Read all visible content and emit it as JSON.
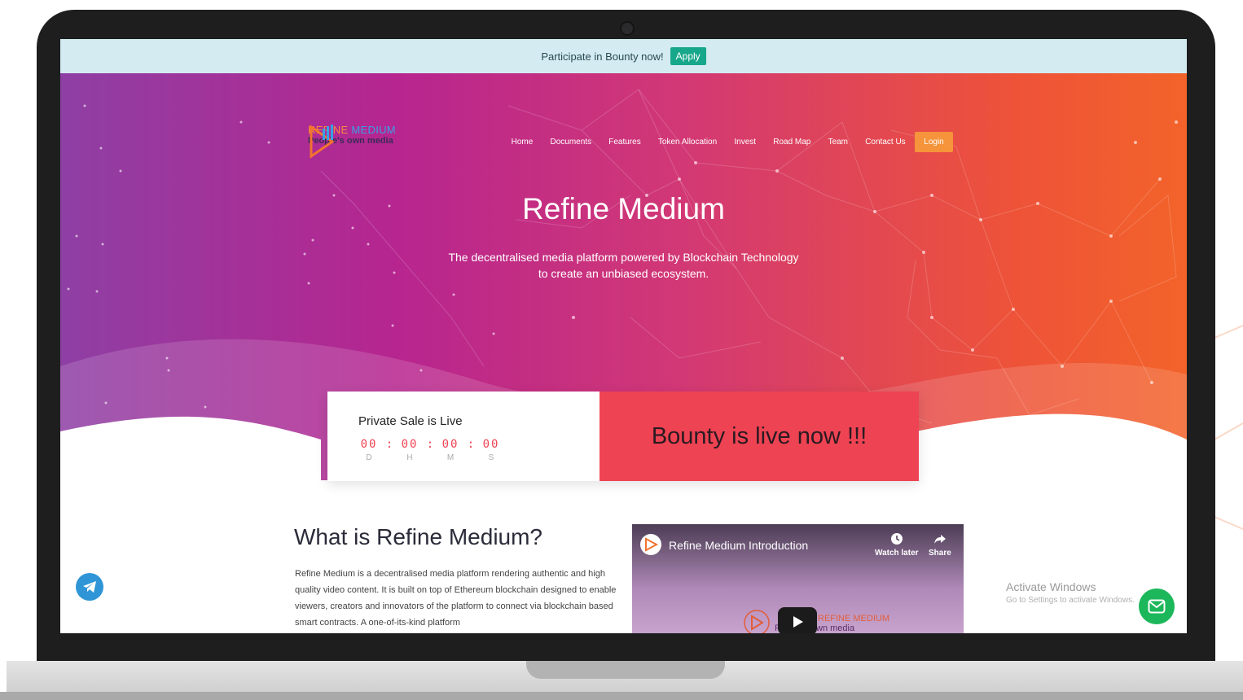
{
  "topbar": {
    "text": "Participate in Bounty now!",
    "apply_label": "Apply"
  },
  "logo": {
    "title_part1": "REFINE",
    "title_part2": "MEDIUM",
    "subtitle": "People's own media"
  },
  "nav": {
    "items": [
      "Home",
      "Documents",
      "Features",
      "Token Allocation",
      "Invest",
      "Road Map",
      "Team",
      "Contact Us"
    ],
    "login_label": "Login"
  },
  "hero": {
    "title": "Refine Medium",
    "subtitle_line1": "The decentralised media platform powered by Blockchain Technology",
    "subtitle_line2": "to create an unbiased ecosystem."
  },
  "sale": {
    "title": "Private Sale is Live",
    "days": "00",
    "hours": "00",
    "minutes": "00",
    "seconds": "00",
    "separator": ":",
    "days_label": "D",
    "hours_label": "H",
    "minutes_label": "M",
    "seconds_label": "S"
  },
  "bounty": {
    "text": "Bounty is live now !!!"
  },
  "about": {
    "title": "What is Refine Medium?",
    "body": "Refine Medium is a decentralised media platform rendering authentic and high quality video content. It is built on top of Ethereum blockchain designed to enable viewers, creators and innovators of the platform to connect via blockchain based smart contracts. A one-of-its-kind platform"
  },
  "video": {
    "title": "Refine Medium Introduction",
    "watch_later": "Watch later",
    "share": "Share",
    "logo_text": "REFINE MEDIUM",
    "logo_sub": "People's own media"
  },
  "windows_notice": {
    "line1": "Activate Windows",
    "line2": "Go to Settings to activate Windows."
  },
  "colors": {
    "accent_red": "#ee4352",
    "login_orange": "#f5943a",
    "apply_green": "#17a78a",
    "telegram_blue": "#2f95d7",
    "mail_green": "#1cb75a"
  },
  "icons": {
    "telegram": "telegram-icon",
    "mail": "mail-icon",
    "clock": "clock-icon",
    "share": "share-arrow-icon",
    "play": "play-icon"
  }
}
